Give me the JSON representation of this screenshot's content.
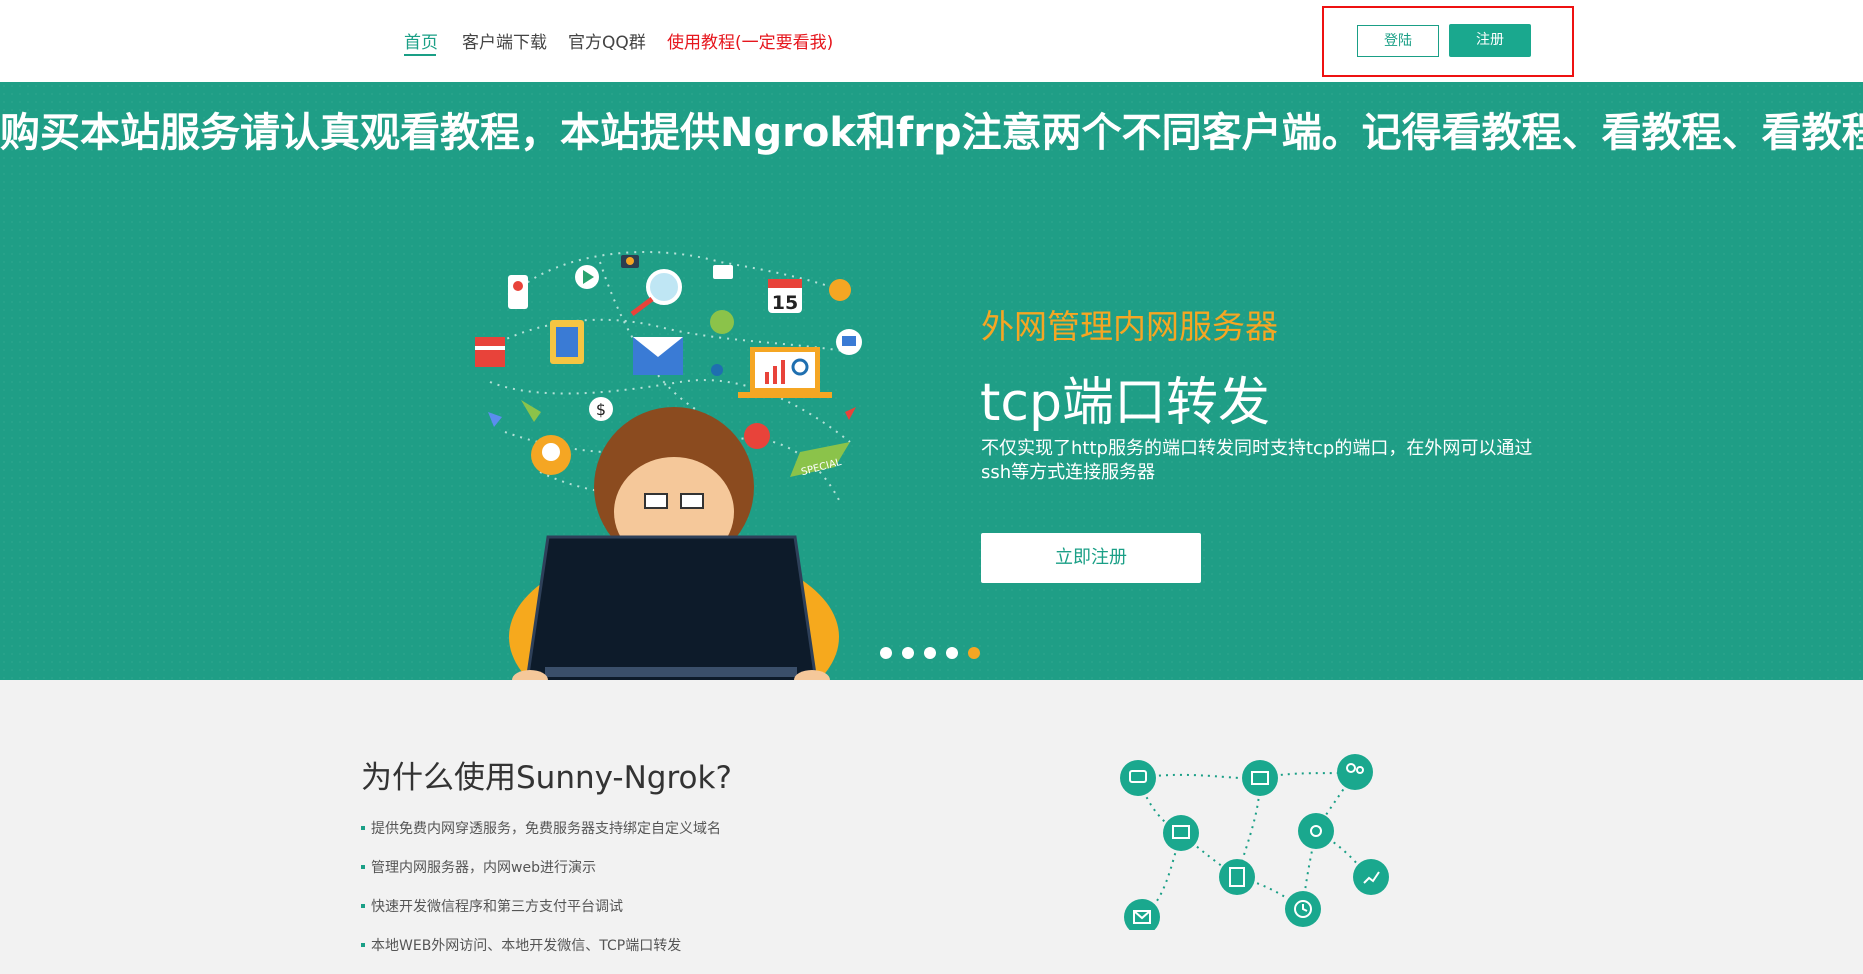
{
  "nav": {
    "items": [
      {
        "label": "首页",
        "active": true
      },
      {
        "label": "客户端下载"
      },
      {
        "label": "官方QQ群"
      },
      {
        "label": "使用教程(一定要看我)",
        "highlight": "#e6161d"
      }
    ],
    "login_label": "登陆",
    "register_label": "注册"
  },
  "banner": {
    "marquee": "购买本站服务请认真观看教程，本站提供Ngrok和frp注意两个不同客户端。记得看教程、看教程、看教程。",
    "subtitle": "外网管理内网服务器",
    "title": "tcp端口转发",
    "description": "不仅实现了http服务的端口转发同时支持tcp的端口，在外网可以通过ssh等方式连接服务器",
    "cta_label": "立即注册",
    "illustration": {
      "calendar_day": "15",
      "tag_text": "SPECIAL"
    },
    "carousel": {
      "count": 5,
      "active_index": 4
    }
  },
  "why": {
    "title": "为什么使用Sunny-Ngrok?",
    "items": [
      "提供免费内网穿透服务，免费服务器支持绑定自定义域名",
      "管理内网服务器，内网web进行演示",
      "快速开发微信程序和第三方支付平台调试",
      "本地WEB外网访问、本地开发微信、TCP端口转发"
    ]
  },
  "colors": {
    "brand": "#1a9f86",
    "accent": "#f5a623",
    "alert": "#e6161d"
  }
}
